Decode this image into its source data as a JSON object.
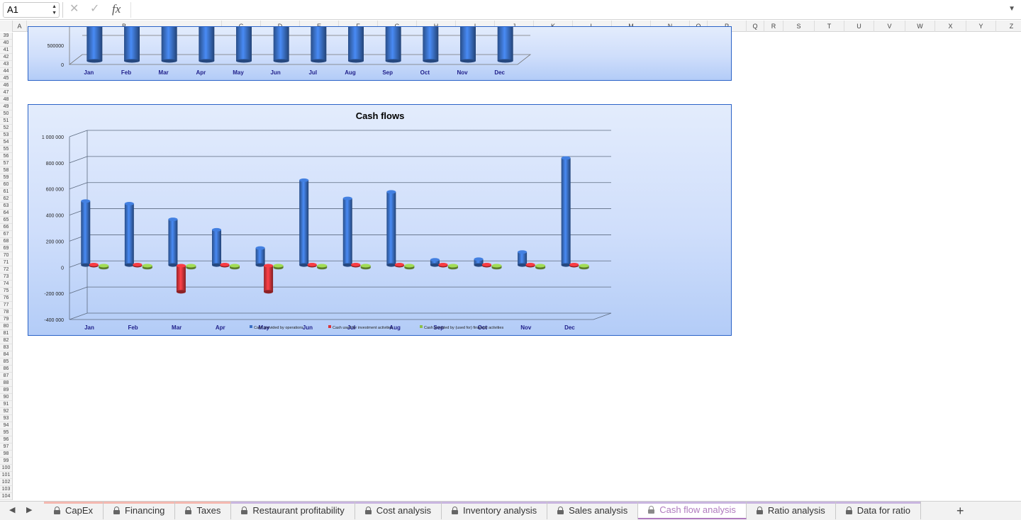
{
  "formula_bar": {
    "cell_ref": "A1",
    "fx_label": "fx",
    "formula": ""
  },
  "columns": [
    "A",
    "B",
    "C",
    "D",
    "E",
    "F",
    "G",
    "H",
    "I",
    "J",
    "K",
    "L",
    "M",
    "N",
    "O",
    "P",
    "Q",
    "R",
    "S",
    "T",
    "U",
    "V",
    "W",
    "X",
    "Y",
    "Z"
  ],
  "rows": {
    "labels": [
      "39",
      "40",
      "41",
      "42",
      "43",
      "44",
      "45",
      "46",
      "47",
      "48",
      "49",
      "50",
      "51",
      "52",
      "53",
      "54",
      "55",
      "56",
      "57",
      "58",
      "59",
      "60",
      "61",
      "62",
      "63",
      "64",
      "65",
      "66",
      "67",
      "68",
      "69",
      "70",
      "71",
      "72",
      "73",
      "74",
      "75",
      "76",
      "77",
      "78",
      "79",
      "80",
      "81",
      "82",
      "83",
      "84",
      "85",
      "86",
      "87",
      "88",
      "89",
      "90",
      "91",
      "92",
      "93",
      "94",
      "95",
      "96",
      "97",
      "98",
      "99",
      "100",
      "101",
      "102",
      "103",
      "104"
    ]
  },
  "chart_top": {
    "chart_data": {
      "type": "bar",
      "categories": [
        "Jan",
        "Feb",
        "Mar",
        "Apr",
        "May",
        "Jun",
        "Jul",
        "Aug",
        "Sep",
        "Oct",
        "Nov",
        "Dec"
      ],
      "y_ticks": [
        "500000",
        "0"
      ],
      "color": "#3a6fc4",
      "note": "top of chart scrolled out of view"
    }
  },
  "chart_cash": {
    "chart_data": {
      "type": "bar",
      "title": "Cash flows",
      "categories": [
        "Jan",
        "Feb",
        "Mar",
        "Apr",
        "May",
        "Jun",
        "Jul",
        "Aug",
        "Sep",
        "Oct",
        "Nov",
        "Dec"
      ],
      "ylim": [
        -400000,
        1000000
      ],
      "y_ticks": [
        {
          "value": 1000000,
          "label": "1 000 000"
        },
        {
          "value": 800000,
          "label": "800 000"
        },
        {
          "value": 600000,
          "label": "600 000"
        },
        {
          "value": 400000,
          "label": "400 000"
        },
        {
          "value": 200000,
          "label": "200 000"
        },
        {
          "value": 0,
          "label": "0"
        },
        {
          "value": -200000,
          "label": "-200 000"
        },
        {
          "value": -400000,
          "label": "-400 000"
        }
      ],
      "series": [
        {
          "name": "Cash provided by operations",
          "color": "#3a6fc4",
          "values": [
            490000,
            470000,
            350000,
            270000,
            130000,
            650000,
            510000,
            560000,
            40000,
            45000,
            100000,
            820000
          ]
        },
        {
          "name": "Cash used for investment activities",
          "color": "#d9343a",
          "values": [
            0,
            0,
            -200000,
            0,
            -200000,
            0,
            0,
            0,
            0,
            0,
            0,
            0
          ]
        },
        {
          "name": "Cash provided by (used for) financial activities",
          "color": "#8dc04a",
          "values": [
            -15000,
            -15000,
            -15000,
            -15000,
            -15000,
            -15000,
            -15000,
            -15000,
            -15000,
            -15000,
            -15000,
            -15000
          ]
        }
      ],
      "legend_position": "bottom",
      "grid": true
    }
  },
  "tabs": [
    {
      "label": "CapEx",
      "locked": true,
      "active": false,
      "color": "#f4b8b0"
    },
    {
      "label": "Financing",
      "locked": true,
      "active": false,
      "color": "#f4b8b0"
    },
    {
      "label": "Taxes",
      "locked": true,
      "active": false,
      "color": "#f4b8b0"
    },
    {
      "label": "Restaurant profitability",
      "locked": true,
      "active": false,
      "color": "#c9b6e0"
    },
    {
      "label": "Cost analysis",
      "locked": true,
      "active": false,
      "color": "#c9b6e0"
    },
    {
      "label": "Inventory analysis",
      "locked": true,
      "active": false,
      "color": "#c9b6e0"
    },
    {
      "label": "Sales analysis",
      "locked": true,
      "active": false,
      "color": "#c9b6e0"
    },
    {
      "label": "Cash flow analysis",
      "locked": true,
      "active": true,
      "color": "#c9b6e0"
    },
    {
      "label": "Ratio analysis",
      "locked": true,
      "active": false,
      "color": "#c9b6e0"
    },
    {
      "label": "Data for ratio",
      "locked": true,
      "active": false,
      "color": "#c9b6e0"
    }
  ],
  "add_sheet_label": "+"
}
